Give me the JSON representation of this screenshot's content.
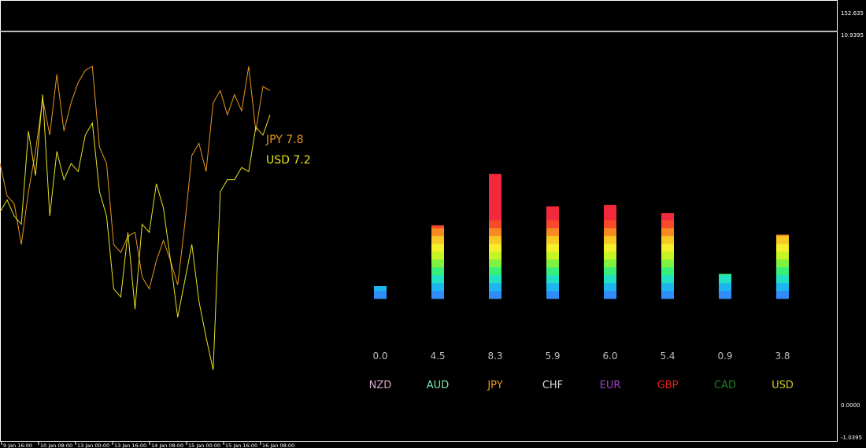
{
  "chart_data": {
    "type": "line",
    "y_axis": {
      "ticks": [
        "152.635",
        "10.9395",
        "0.0000",
        "-1.0395"
      ]
    },
    "x_axis": {
      "ticks": [
        "9 Jan 16:00",
        "10 Jan 08:00",
        "13 Jan 00:00",
        "13 Jan 16:00",
        "14 Jan 08:00",
        "15 Jan 00:00",
        "15 Jan 16:00",
        "16 Jan 08:00"
      ]
    },
    "grid": false,
    "line_series": [
      {
        "name": "JPY",
        "label": "JPY 7.8",
        "color": "#e8961e",
        "values": [
          6.0,
          5.2,
          5.0,
          4.0,
          5.3,
          6.3,
          7.6,
          6.7,
          8.2,
          6.8,
          7.5,
          8.0,
          8.3,
          8.4,
          6.4,
          6.0,
          4.0,
          3.8,
          4.2,
          4.3,
          3.2,
          2.9,
          3.6,
          4.1,
          3.6,
          3.0,
          4.5,
          6.2,
          6.5,
          5.8,
          7.5,
          7.8,
          7.2,
          7.7,
          7.3,
          8.4,
          6.8,
          7.9,
          7.8
        ]
      },
      {
        "name": "USD",
        "label": "USD 7.2",
        "color": "#e8e21e",
        "values": [
          4.8,
          5.1,
          4.7,
          4.5,
          6.8,
          5.7,
          7.7,
          4.7,
          6.3,
          5.6,
          6.0,
          5.8,
          6.7,
          7.0,
          5.3,
          4.7,
          2.9,
          2.7,
          4.3,
          2.4,
          4.5,
          4.3,
          5.5,
          4.9,
          3.6,
          2.2,
          3.1,
          4.0,
          2.6,
          1.7,
          0.9,
          5.3,
          5.6,
          5.6,
          5.9,
          5.8,
          6.9,
          6.7,
          7.2
        ]
      }
    ],
    "bar_series": {
      "type": "bar",
      "categories": [
        "NZD",
        "AUD",
        "JPY",
        "CHF",
        "EUR",
        "GBP",
        "CAD",
        "USD"
      ],
      "category_colors": [
        "#d8a8c8",
        "#7de8a8",
        "#e8961e",
        "#d8d8d8",
        "#a040c8",
        "#e02020",
        "#208020",
        "#c8c820"
      ],
      "values": [
        0.0,
        4.5,
        8.3,
        5.9,
        6.0,
        5.4,
        0.9,
        3.8
      ],
      "value_labels": [
        "0.0",
        "4.5",
        "8.3",
        "5.9",
        "6.0",
        "5.4",
        "0.9",
        "3.8"
      ],
      "gradient": [
        "#2f8cf8",
        "#1fb6f0",
        "#22e0c4",
        "#36f07a",
        "#7ef23e",
        "#c6f424",
        "#f6f02a",
        "#f8c824",
        "#f88a22",
        "#f84a2a",
        "#f02a3a"
      ]
    }
  }
}
